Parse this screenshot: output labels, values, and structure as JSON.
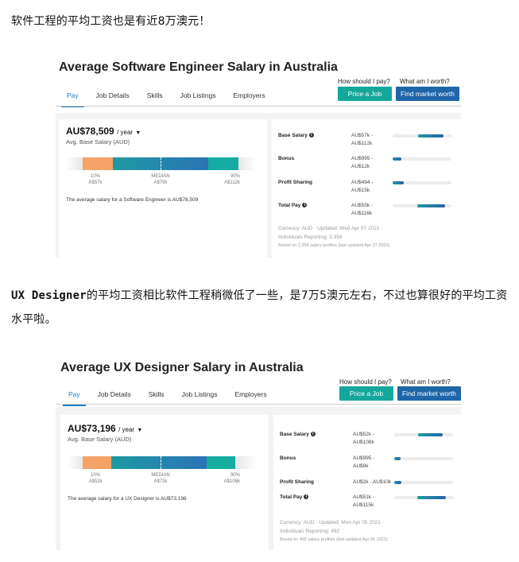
{
  "intro": "软件工程的平均工资也是有近8万澳元！",
  "middle": {
    "latin": "UX Designer",
    "rest": "的平均工资相比软件工程稍微低了一些，是7万5澳元左右，不过也算很好的平均工资水平啦。"
  },
  "cards": [
    {
      "title": "Average Software Engineer Salary in Australia",
      "tabs": [
        "Pay",
        "Job Details",
        "Skills",
        "Job Listings",
        "Employers"
      ],
      "q1": "How should I pay?",
      "q2": "What am I worth?",
      "btn1": "Price a Job",
      "btn2": "Find market worth",
      "salary": "AU$78,509",
      "per": "/ year",
      "sub": "Avg. Base Salary (AUD)",
      "dist": {
        "p10": 57,
        "median": 79,
        "p90": 112,
        "unit": "k AUD"
      },
      "ticks": {
        "p10_label": "10%",
        "p10_value": "A$57k",
        "median_label": "MEDIAN",
        "median_value": "A$79k",
        "p90_label": "90%",
        "p90_value": "A$112k"
      },
      "avg_text": "The average salary for a Software Engineer is AU$78,509",
      "rows": [
        {
          "label": "Base Salary",
          "info": "i",
          "range1": "AU$57k -",
          "range2": "AU$112k",
          "lo": 57,
          "hi": 112
        },
        {
          "label": "Bonus",
          "info": "",
          "range1": "AU$995 -",
          "range2": "AU$12k",
          "lo": 1,
          "hi": 12
        },
        {
          "label": "Profit Sharing",
          "info": "",
          "range1": "AU$494 -",
          "range2": "AU$15k",
          "lo": 0.5,
          "hi": 15
        },
        {
          "label": "Total Pay",
          "info": "i",
          "range1": "AU$55k -",
          "range2": "AU$116k",
          "lo": 55,
          "hi": 116
        }
      ],
      "foot1": "Currency: AUD · Updated: Wed Apr 07 2021 ·",
      "foot2": "Individuals Reporting: 2,358",
      "foot3": "Based on 2,358 salary profiles (last updated Apr 07 2021)"
    },
    {
      "title": "Average UX Designer Salary in Australia",
      "tabs": [
        "Pay",
        "Job Details",
        "Skills",
        "Job Listings",
        "Employers"
      ],
      "q1": "How should I pay?",
      "q2": "What am I worth?",
      "btn1": "Price a Job",
      "btn2": "Find market worth",
      "salary": "AU$73,196",
      "per": "/ year",
      "sub": "Avg. Base Salary (AUD)",
      "dist": {
        "p10": 52,
        "median": 73,
        "p90": 108,
        "unit": "k AUD"
      },
      "ticks": {
        "p10_label": "10%",
        "p10_value": "A$52k",
        "median_label": "MEDIAN",
        "median_value": "A$73k",
        "p90_label": "90%",
        "p90_value": "A$108k"
      },
      "avg_text": "The average salary for a UX Designer is AU$73,196",
      "rows": [
        {
          "label": "Base Salary",
          "info": "i",
          "range1": "AU$52k -",
          "range2": "AU$108k",
          "lo": 52,
          "hi": 108
        },
        {
          "label": "Bonus",
          "info": "",
          "range1": "AU$995 -",
          "range2": "AU$9k",
          "lo": 1,
          "hi": 9
        },
        {
          "label": "Profit Sharing",
          "info": "",
          "range1": "AU$2k - AU$10k",
          "range2": "",
          "lo": 2,
          "hi": 10
        },
        {
          "label": "Total Pay",
          "info": "i",
          "range1": "AU$51k -",
          "range2": "AU$115k",
          "lo": 51,
          "hi": 115
        }
      ],
      "foot1": "Currency: AUD · Updated: Mon Apr 05 2021 ·",
      "foot2": "Individuals Reporting: 492",
      "foot3": "Based on 492 salary profiles (last updated Apr 05 2021)"
    }
  ],
  "colors": {
    "accent": "#1f7dc4",
    "teal_button": "#14a79c",
    "blue_button": "#1f66a8",
    "orange": "#f4a266"
  }
}
